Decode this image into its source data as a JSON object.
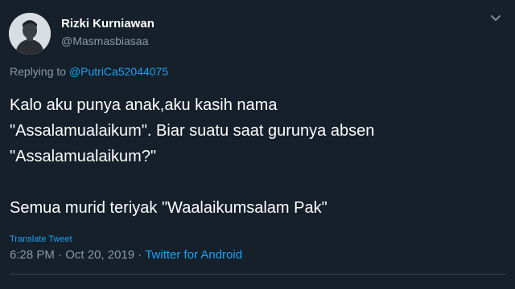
{
  "author": {
    "display_name": "Rizki Kurniawan",
    "handle": "@Masmasbiasaa"
  },
  "reply": {
    "prefix": "Replying to",
    "to_handle": "@PutriCa52044075"
  },
  "tweet": {
    "lines": [
      "Kalo aku punya anak,aku kasih nama",
      "\"Assalamualaikum\". Biar suatu saat gurunya absen",
      "\"Assalamualaikum?\"",
      "Semua murid teriyak \"Waalaikumsalam Pak\""
    ]
  },
  "translate_label": "Translate Tweet",
  "meta": {
    "time": "6:28 PM",
    "sep1": " · ",
    "date": "Oct 20, 2019",
    "sep2": " · ",
    "source": "Twitter for Android"
  },
  "icons": {
    "menu": "chevron-down-icon",
    "avatar": "avatar"
  },
  "colors": {
    "background": "#15202b",
    "text": "#ffffff",
    "secondary": "#8899a6",
    "link": "#1da1f2"
  }
}
